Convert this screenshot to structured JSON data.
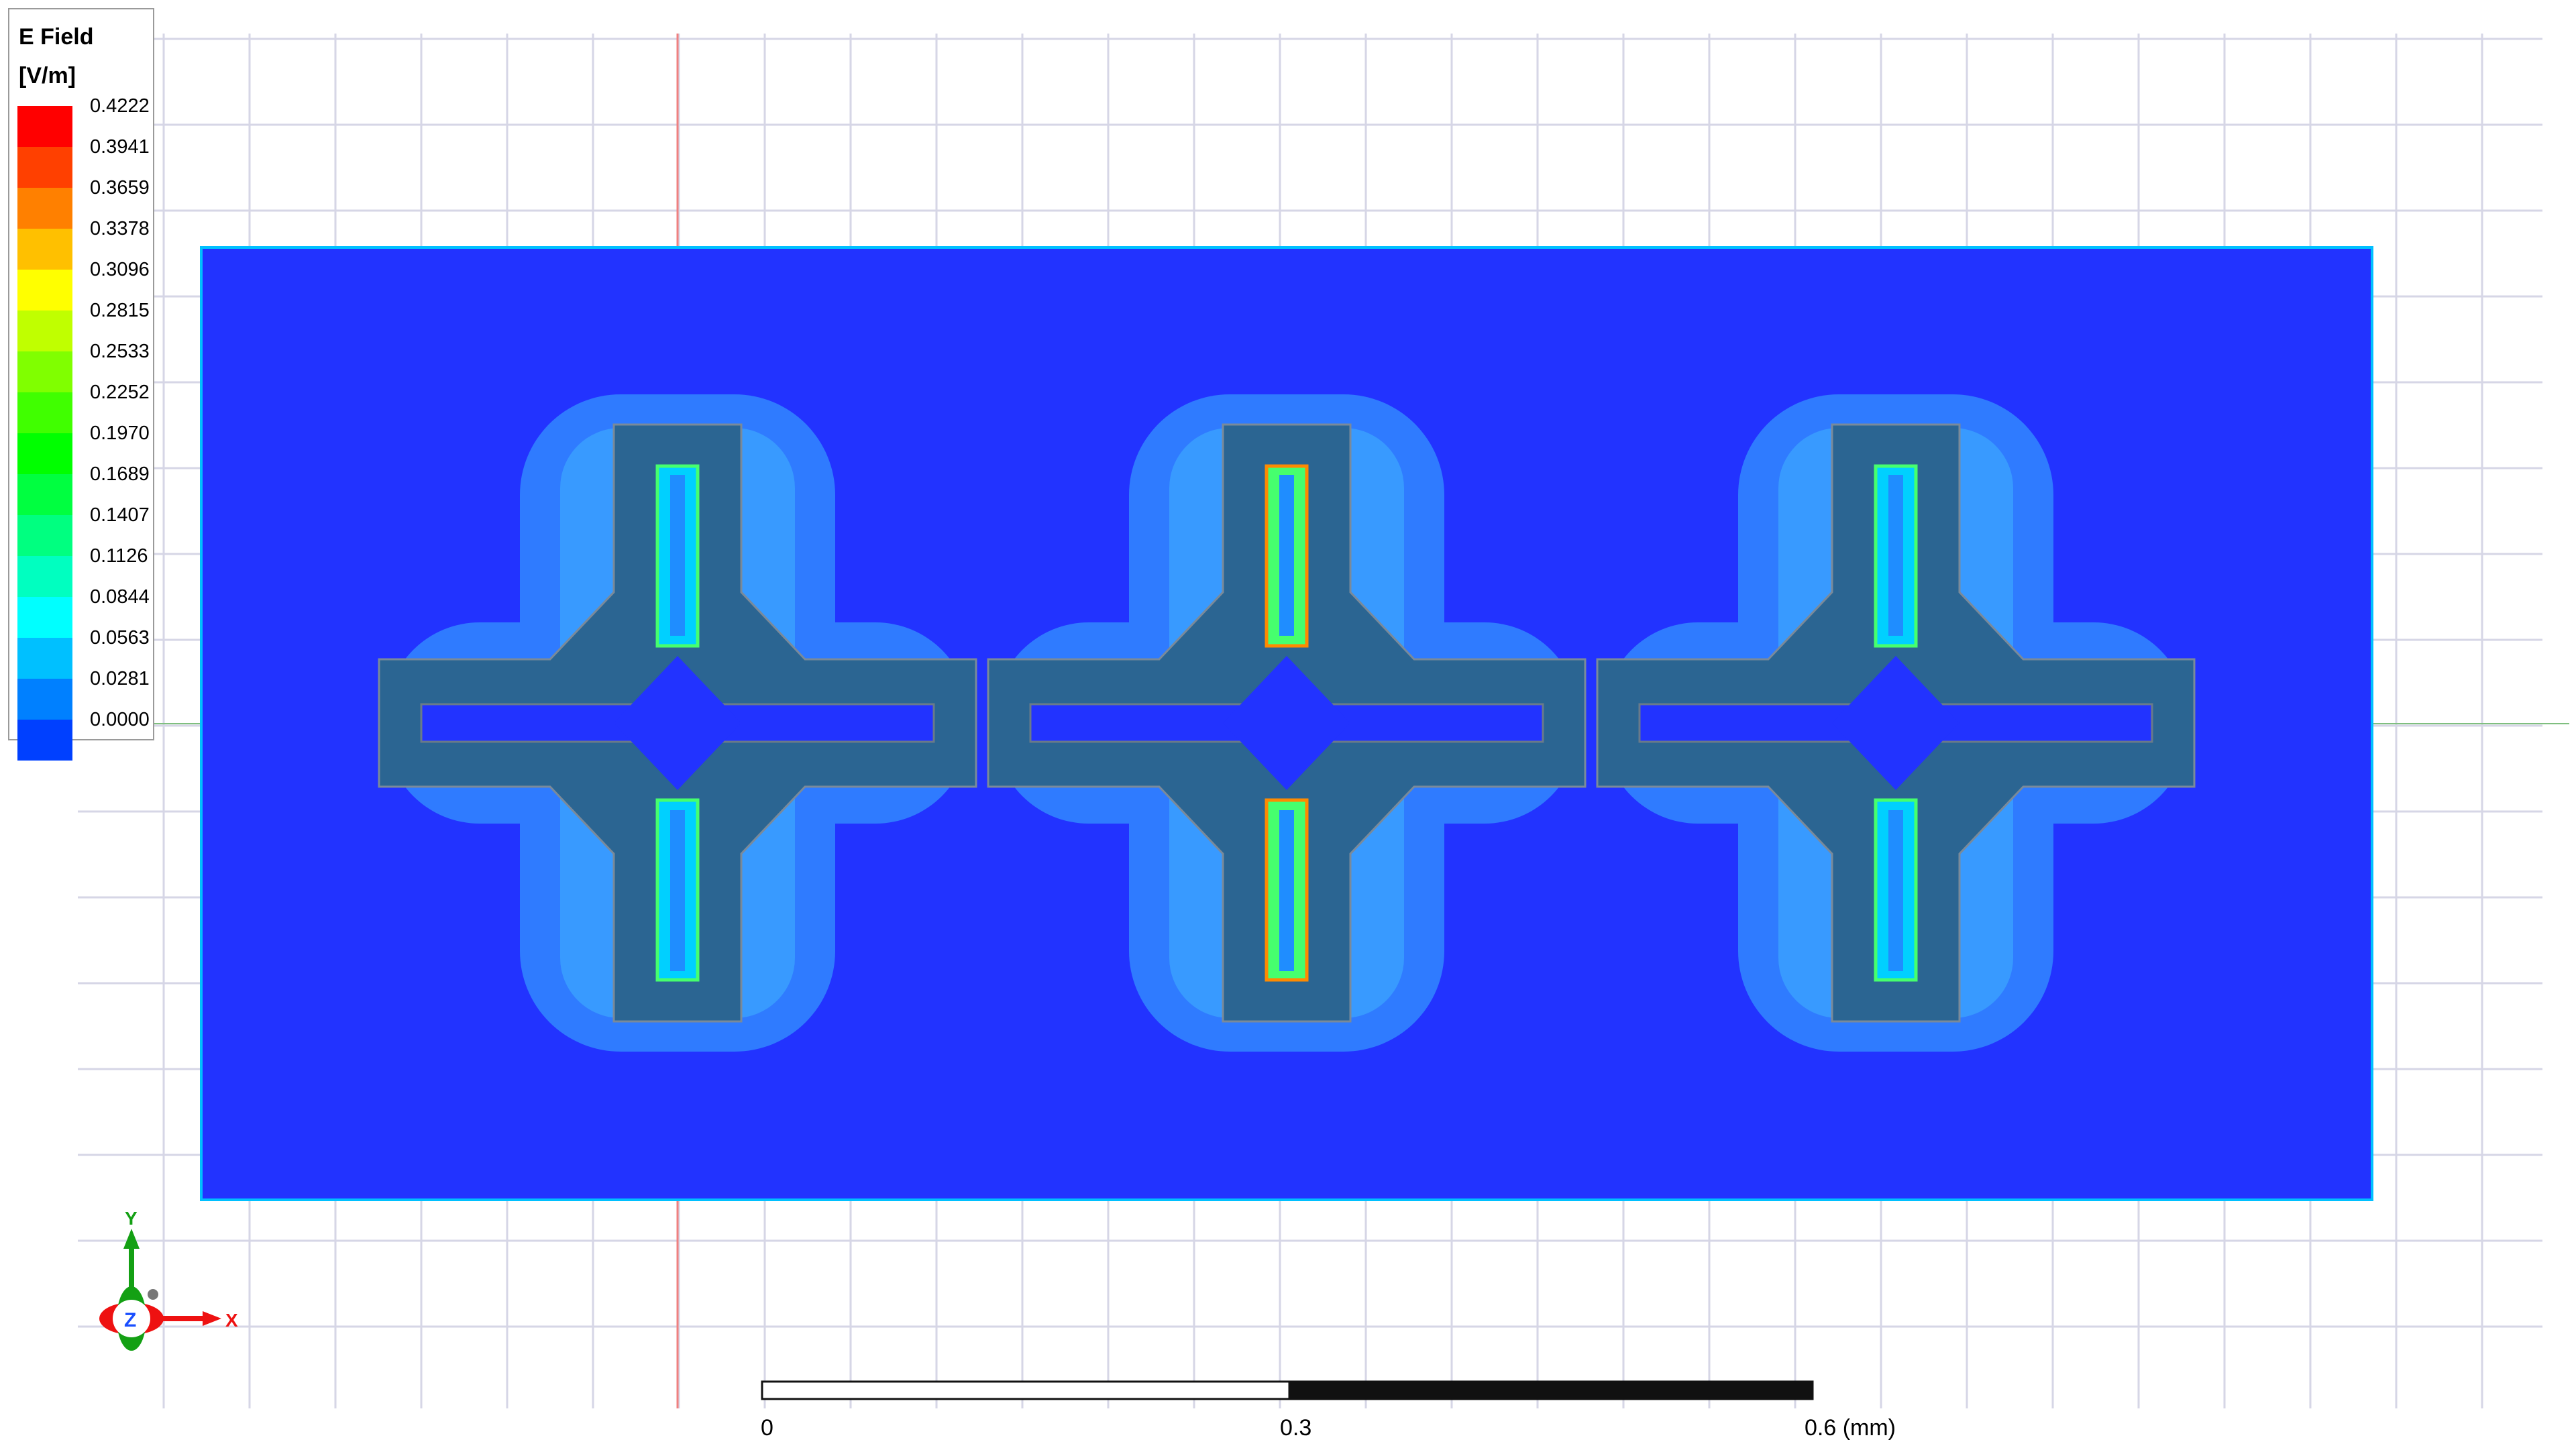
{
  "legend": {
    "title": "E Field",
    "units": "[V/m]",
    "ticks": [
      "0.4222",
      "0.3941",
      "0.3659",
      "0.3378",
      "0.3096",
      "0.2815",
      "0.2533",
      "0.2252",
      "0.1970",
      "0.1689",
      "0.1407",
      "0.1126",
      "0.0844",
      "0.0563",
      "0.0281",
      "0.0000"
    ],
    "colors": [
      "#ff0000",
      "#ff4000",
      "#ff8000",
      "#ffc000",
      "#ffff00",
      "#c0ff00",
      "#80ff00",
      "#40ff00",
      "#00ff00",
      "#00ff40",
      "#00ff80",
      "#00ffc0",
      "#00ffff",
      "#00c0ff",
      "#0080ff",
      "#0040ff"
    ]
  },
  "scale_bar": {
    "labels": [
      "0",
      "0.3",
      "0.6 (mm)"
    ]
  },
  "triad": {
    "y_label": "Y",
    "x_label": "X",
    "z_label": "Z"
  },
  "colors": {
    "background": "#ffffff",
    "grid": "#d6d6e6",
    "substrate": "#2233ff",
    "metal": "#2b6592",
    "field_low": "#2f7bff",
    "field_mid": "#00d0ff",
    "field_high": "#46ff6e",
    "field_peak": "#ff8a00"
  }
}
